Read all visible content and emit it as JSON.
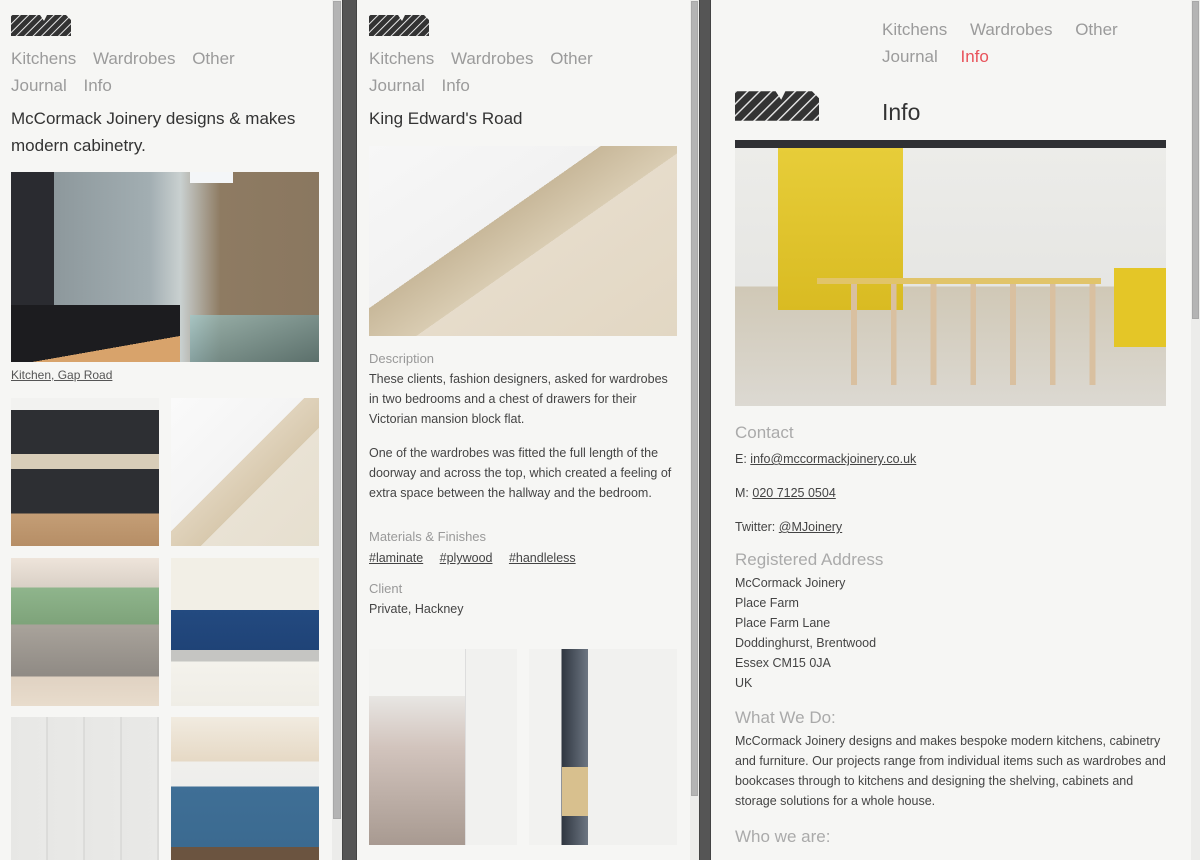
{
  "nav": {
    "items": [
      {
        "label": "Kitchens"
      },
      {
        "label": "Wardrobes"
      },
      {
        "label": "Other"
      },
      {
        "label": "Journal"
      },
      {
        "label": "Info"
      }
    ],
    "active_color": "#e8525a"
  },
  "panel_home": {
    "tagline": "McCormack Joinery designs & makes modern cabinetry.",
    "featured": {
      "caption": "Kitchen, Gap Road",
      "image": "kitchen-gap-road-photo"
    },
    "thumbnails": [
      {
        "image": "black-kitchen-photo"
      },
      {
        "image": "plywood-drawer-photo"
      },
      {
        "image": "kitchen-island-photo"
      },
      {
        "image": "blue-tile-kitchen-photo"
      },
      {
        "image": "white-wardrobe-photo"
      },
      {
        "image": "blue-island-kitchen-photo"
      }
    ]
  },
  "panel_project": {
    "title": "King Edward's Road",
    "description_label": "Description",
    "description": [
      "These clients, fashion designers, asked for wardrobes in two bedrooms and a chest of drawers for their Victorian mansion block flat.",
      "One of the wardrobes was fitted the full length of the doorway and across the top, which created a feeling of extra space between the hallway and the bedroom."
    ],
    "materials_label": "Materials & Finishes",
    "tags": [
      "#laminate",
      "#plywood",
      "#handleless"
    ],
    "client_label": "Client",
    "client": "Private, Hackney"
  },
  "panel_info": {
    "title": "Info",
    "contact_heading": "Contact",
    "email_prefix": "E:",
    "email": "info@mccormackjoinery.co.uk",
    "phone_prefix": "M:",
    "phone": "020 7125 0504",
    "twitter_prefix": "Twitter:",
    "twitter": "@MJoinery",
    "address_heading": "Registered Address",
    "address": [
      "McCormack Joinery",
      "Place Farm",
      "Place Farm Lane",
      "Doddinghurst, Brentwood",
      "Essex CM15 0JA",
      "UK"
    ],
    "what_heading": "What We Do:",
    "what_text": "McCormack Joinery designs and makes bespoke modern kitchens, cabinetry and furniture. Our projects range from individual items such as wardrobes and bookcases through to kitchens and designing the shelving, cabinets and storage solutions for a whole house.",
    "who_heading": "Who we are:"
  }
}
